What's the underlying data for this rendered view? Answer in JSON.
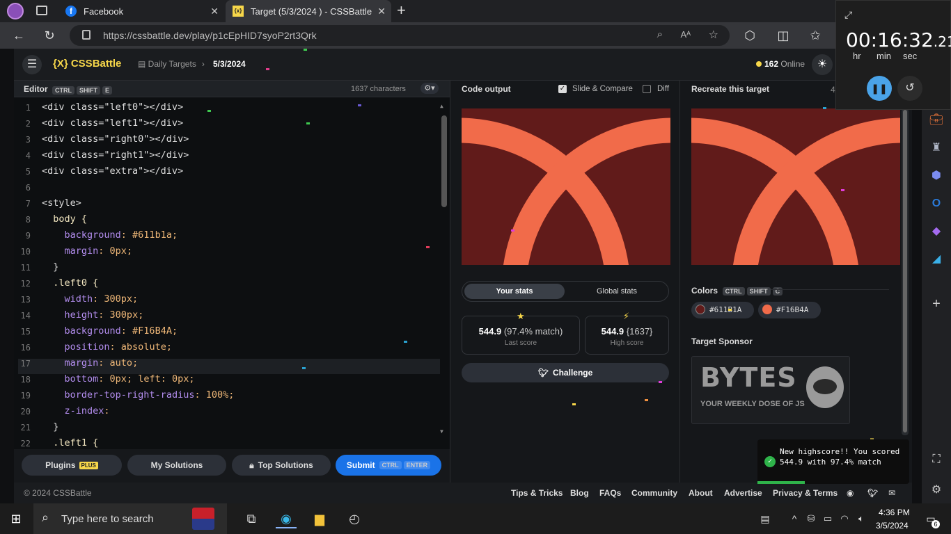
{
  "browser": {
    "tabs": [
      {
        "label": "Facebook",
        "close": "✕"
      },
      {
        "label": "Target (5/3/2024 ) - CSSBattle",
        "close": "✕"
      }
    ],
    "new_tab": "+",
    "url": "https://cssbattle.dev/play/p1cEpHID7syoP2rt3Qrk"
  },
  "site": {
    "logo": "{X} CSSBattle",
    "breadcrumb_parent": "Daily Targets",
    "breadcrumb_current": "5/3/2024",
    "online_count": "162",
    "online_label": "Online"
  },
  "editor": {
    "title": "Editor",
    "shortcut": [
      "CTRL",
      "SHIFT",
      "E"
    ],
    "chars": "1637 characters",
    "lines": [
      {
        "n": "1",
        "t": "<div class=\"left0\"></div>"
      },
      {
        "n": "2",
        "t": "<div class=\"left1\"></div>"
      },
      {
        "n": "3",
        "t": "<div class=\"right0\"></div>"
      },
      {
        "n": "4",
        "t": "<div class=\"right1\"></div>"
      },
      {
        "n": "5",
        "t": "<div class=\"extra\"></div>"
      },
      {
        "n": "6",
        "t": ""
      },
      {
        "n": "7",
        "t": "<style>"
      },
      {
        "n": "8",
        "t": "  body {"
      },
      {
        "n": "9",
        "t": "    background: #611b1a;"
      },
      {
        "n": "10",
        "t": "    margin: 0px;"
      },
      {
        "n": "11",
        "t": "  }"
      },
      {
        "n": "12",
        "t": "  .left0 {"
      },
      {
        "n": "13",
        "t": "    width: 300px;"
      },
      {
        "n": "14",
        "t": "    height: 300px;"
      },
      {
        "n": "15",
        "t": "    background: #F16B4A;"
      },
      {
        "n": "16",
        "t": "    position: absolute;"
      },
      {
        "n": "17",
        "t": "    margin: auto;"
      },
      {
        "n": "18",
        "t": "    bottom: 0px; left: 0px;"
      },
      {
        "n": "19",
        "t": "    border-top-right-radius: 100%;"
      },
      {
        "n": "20",
        "t": "    z-index:"
      },
      {
        "n": "21",
        "t": "  }"
      },
      {
        "n": "22",
        "t": "  .left1 {"
      }
    ]
  },
  "buttons": {
    "plugins": "Plugins",
    "plugins_badge": "PLUS",
    "my_solutions": "My Solutions",
    "top_solutions": "Top Solutions",
    "submit": "Submit",
    "submit_keys": [
      "CTRL",
      "ENTER"
    ]
  },
  "output": {
    "title": "Code output",
    "slide_compare": "Slide & Compare",
    "diff": "Diff",
    "tab_your": "Your stats",
    "tab_global": "Global stats",
    "last_score": "544.9",
    "last_match": "(97.4% match)",
    "last_label": "Last score",
    "high_score": "544.9",
    "high_chars": "{1637}",
    "high_label": "High score",
    "challenge": "Challenge"
  },
  "target": {
    "title": "Recreate this target",
    "width_partial": "4",
    "colors_label": "Colors",
    "colors_keys": [
      "CTRL",
      "SHIFT",
      "C"
    ],
    "colors": [
      "#611B1A",
      "#F16B4A"
    ],
    "sponsor_label": "Target Sponsor",
    "sponsor_big": "BYTES",
    "sponsor_small": "YOUR WEEKLY DOSE OF JS"
  },
  "footer": {
    "copyright": "© 2024 CSSBattle",
    "links": [
      "Tips & Tricks",
      "Blog",
      "FAQs",
      "Community",
      "About",
      "Advertise",
      "Privacy & Terms"
    ]
  },
  "stopwatch": {
    "time": "00:16:32",
    "fraction": ".21",
    "units": [
      "hr",
      "min",
      "sec"
    ]
  },
  "toast": {
    "message": "New highscore!! You scored 544.9 with 97.4% match"
  },
  "taskbar": {
    "search_placeholder": "Type here to search",
    "time": "4:36 PM",
    "date": "3/5/2024",
    "notifications": "6"
  },
  "colors": {
    "bg_dark": "#611b1a",
    "accent_orange": "#F16B4A",
    "submit_blue": "#1a73e8",
    "logo_yellow": "#f7d74a"
  }
}
